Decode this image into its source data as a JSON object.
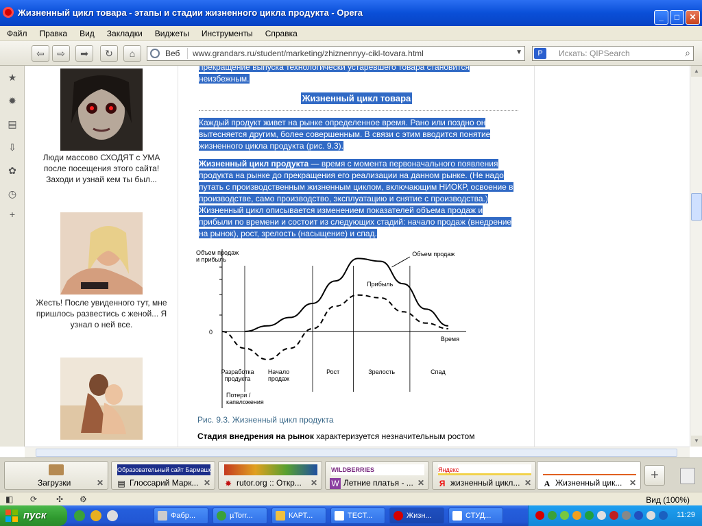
{
  "window": {
    "title": "Жизненный цикл товара - этапы и стадии жизненного цикла продукта - Opera"
  },
  "menu": [
    "Файл",
    "Правка",
    "Вид",
    "Закладки",
    "Виджеты",
    "Инструменты",
    "Справка"
  ],
  "address": {
    "web_label": "Веб",
    "url_prefix": "www.grandars.ru",
    "url_rest": "/student/marketing/zhiznennyy-cikl-tovara.html"
  },
  "search": {
    "placeholder": "Искать: QIPSearch"
  },
  "sidebar_ads": [
    {
      "text": "Люди массово СХОДЯТ с УМА после посещения этого сайта! Заходи и узнай кем ты был..."
    },
    {
      "text": "Жесть! После увиденного тут, мне пришлось развестись с женой... Я узнал о ней все."
    }
  ],
  "article": {
    "top_fragment_1": "прекращение выпуска технологически устаревшего товара становится",
    "top_fragment_2": "неизбежным.",
    "heading": "Жизненный цикл товара",
    "para1": "Каждый продукт живет на рынке определенное время. Рано или поздно он вытесняется другим, более совершенным. В связи с этим вводится понятие жизненного цикла продукта (рис. 9.3).",
    "para2_term": "Жизненный цикл продукта",
    "para2_body": " — время с момента первоначального появления продукта на рынке до прекращения его реализации на данном рынке. (Не надо путать с производственным жизненным циклом, включающим НИОКР, освоение в производстве, само производство, эксплуатацию и снятие с производства.) Жизненный цикл описывается изменением показателей объема продаж и прибыли по времени и состоит из следующих стадий: начало продаж (внедрение на рынок), рост, зрелость (насыщение) и спад.",
    "caption": "Рис. 9.3. Жизненный цикл продукта",
    "bottom_bold": "Стадия внедрения на рынок",
    "bottom_rest": " характеризуется незначительным ростом"
  },
  "chart_data": {
    "type": "line",
    "ylabel": "Объем продаж\nи прибыль",
    "xlabel": "Время",
    "zero_label": "0",
    "series": [
      {
        "name": "Объем продаж",
        "style": "solid",
        "color": "#000000",
        "x": [
          1,
          2,
          3,
          4,
          5,
          6,
          7,
          8,
          9,
          10
        ],
        "values": [
          0,
          0.4,
          1.0,
          2.0,
          3.6,
          5.2,
          5.0,
          3.4,
          1.6,
          0.4
        ]
      },
      {
        "name": "Прибыль",
        "style": "dashed",
        "color": "#000000",
        "x": [
          0,
          1,
          2,
          3,
          4,
          5,
          6,
          7,
          8,
          9,
          10
        ],
        "values": [
          0,
          -1.2,
          -2.0,
          -1.2,
          0.2,
          1.8,
          2.6,
          2.4,
          1.4,
          0.6,
          0.2
        ]
      }
    ],
    "stages": [
      "Разработка\nпродукта",
      "Начало\nпродаж",
      "Рост",
      "Зрелость",
      "Спад"
    ],
    "loss_label": "Потери /\nкапвложения"
  },
  "tabs": [
    {
      "label": "Загрузки",
      "active": false
    },
    {
      "label": "Глоссарий Марк...",
      "thumb_title": "Образовательный сайт Бармашова К. С.",
      "active": false
    },
    {
      "label": "rutor.org :: Откр...",
      "active": false
    },
    {
      "label": "Летние платья - ...",
      "thumb_title": "WILDBERRIES",
      "active": false
    },
    {
      "label": "жизненный цикл...",
      "thumb_title": "Яндекс",
      "active": false
    },
    {
      "label": "Жизненный цик...",
      "active": true
    }
  ],
  "status": {
    "zoom": "Вид (100%)"
  },
  "taskbar": {
    "start": "пуск",
    "tasks": [
      "Фабр...",
      "µTorr...",
      "КАРТ...",
      "ТЕСТ...",
      "Жизн...",
      "СТУД..."
    ],
    "clock": "11:29"
  }
}
